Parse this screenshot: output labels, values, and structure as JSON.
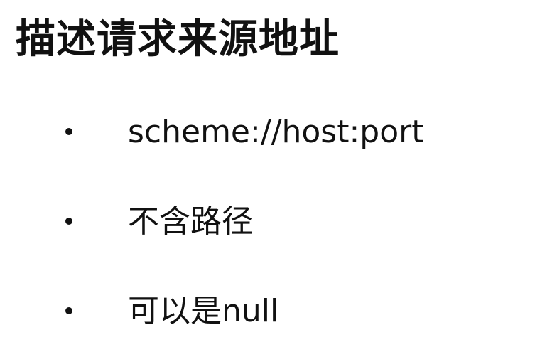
{
  "slide": {
    "title": "描述请求来源地址",
    "bullets": [
      "scheme://host:port",
      "不含路径",
      "可以是null"
    ]
  }
}
